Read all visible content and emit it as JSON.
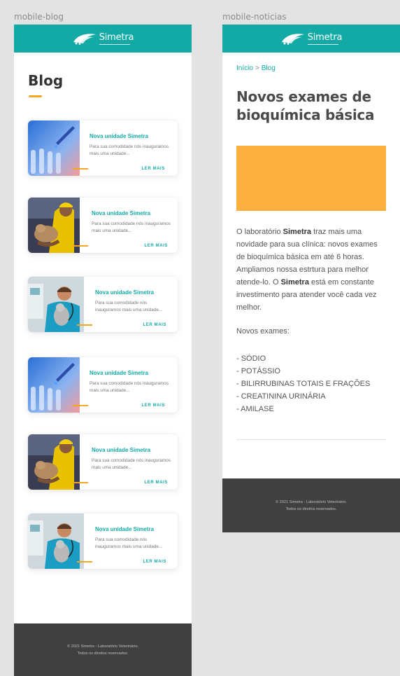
{
  "frames": {
    "blog_label": "mobile-blog",
    "news_label": "mobile-noticias"
  },
  "brand": {
    "name": "Simetra",
    "primary_color": "#13aaa6",
    "accent_color": "#f5a623"
  },
  "blog": {
    "title": "Blog",
    "cards": [
      {
        "title": "Nova unidade Simetra",
        "text": "Para sua comodidade nós inauguramos mais uma unidade...",
        "link": "LER MAIS",
        "image": "lab-test-tubes"
      },
      {
        "title": "Nova unidade Simetra",
        "text": "Para sua comodidade nós inauguramos mais uma unidade...",
        "link": "LER MAIS",
        "image": "man-with-puppy"
      },
      {
        "title": "Nova unidade Simetra",
        "text": "Para sua comodidade nós inauguramos mais uma unidade...",
        "link": "LER MAIS",
        "image": "vet-with-cat"
      },
      {
        "title": "Nova unidade Simetra",
        "text": "Para sua comodidade nós inauguramos mais uma unidade...",
        "link": "LER MAIS",
        "image": "lab-test-tubes"
      },
      {
        "title": "Nova unidade Simetra",
        "text": "Para sua comodidade nós inauguramos mais uma unidade...",
        "link": "LER MAIS",
        "image": "man-with-puppy"
      },
      {
        "title": "Nova unidade Simetra",
        "text": "Para sua comodidade nós inauguramos mais uma unidade...",
        "link": "LER MAIS",
        "image": "vet-with-cat"
      }
    ]
  },
  "footer": {
    "line1": "© 2021  Simetra - Laboratório Veterinário.",
    "line2": "Todos os direitos reservados."
  },
  "news": {
    "breadcrumb_home": "Início",
    "breadcrumb_sep": ">",
    "breadcrumb_current": "Blog",
    "title": "Novos exames de bioquímica básica",
    "hero_color": "#fbb040",
    "body_p1": "O laboratório ",
    "body_b1": "Simetra",
    "body_p2": " traz mais uma novidade para sua clínica: novos exames de bioquímica básica em até 6 horas. Ampliamos nossa estrtura para melhor atende-lo. O ",
    "body_b2": "Simetra",
    "body_p3": " está em constante investimento para atender você cada vez melhor.",
    "exams_label": "Novos exames:",
    "exams": [
      "- SÓDIO",
      "- POTÁSSIO",
      "- BILIRRUBINAS TOTAIS E FRAÇÕES",
      "- CREATININA URINÁRIA",
      "- AMILASE"
    ]
  }
}
